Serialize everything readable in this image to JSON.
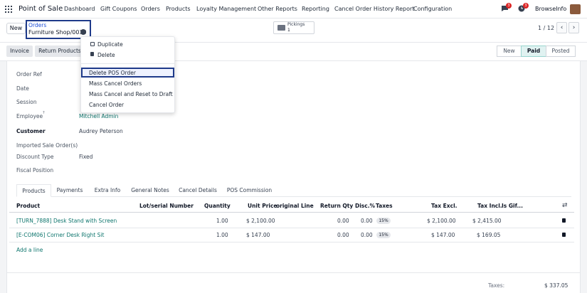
{
  "topnav": {
    "brand": "Point of Sale",
    "menu": [
      "Dashboard",
      "Gift Coupons",
      "Orders",
      "Products",
      "Loyalty Management",
      "Other Reports",
      "Reporting",
      "Cancel Order History Report",
      "Configuration"
    ],
    "chat_badge": "3",
    "activity_badge": "3",
    "user": "BrowseInfo"
  },
  "control": {
    "new_label": "New",
    "breadcrumb_parent": "Orders",
    "breadcrumb_current": "Furniture Shop/0030",
    "pickings_label": "Pickings",
    "pickings_count": "1",
    "pager": "1 / 12",
    "prev": "‹",
    "next": "›"
  },
  "actions": {
    "invoice": "Invoice",
    "return_products": "Return Products"
  },
  "stages": [
    "New",
    "Paid",
    "Posted"
  ],
  "active_stage": "Paid",
  "dropdown": {
    "duplicate": "Duplicate",
    "delete": "Delete",
    "delete_pos_order": "Delete POS Order",
    "mass_cancel": "Mass Cancel Orders",
    "mass_cancel_reset": "Mass Cancel and Reset to Draft",
    "cancel_order": "Cancel Order"
  },
  "form": {
    "order_ref_label": "Order Ref",
    "date_label": "Date",
    "session_label": "Session",
    "employee_label": "Employee",
    "employee_help": "?",
    "employee": "Mitchell Admin",
    "customer_label": "Customer",
    "customer": "Audrey Peterson",
    "imported_label": "Imported Sale Order(s)",
    "discount_type_label": "Discount Type",
    "discount_type": "Fixed",
    "fiscal_position_label": "Fiscal Position"
  },
  "tabs": [
    "Products",
    "Payments",
    "Extra Info",
    "General Notes",
    "Cancel Details",
    "POS Commission"
  ],
  "table": {
    "headers": {
      "product": "Product",
      "lot": "Lot/serial Number",
      "qty": "Quantity",
      "unit_price": "Unit Price",
      "orig_line": "original Line",
      "return_qty": "Return Qty",
      "disc": "Disc.%",
      "taxes": "Taxes",
      "tax_excl": "Tax Excl.",
      "tax_incl": "Tax Incl.",
      "is_gift": "Is Gif..."
    },
    "rows": [
      {
        "product": "[TURN_7888] Desk Stand with Screen",
        "qty": "1.00",
        "unit_price": "$ 2,100.00",
        "return_qty": "0.00",
        "disc": "0.00",
        "tax": "15%",
        "tax_excl": "$ 2,100.00",
        "tax_incl": "$ 2,415.00"
      },
      {
        "product": "[E-COM06] Corner Desk Right Sit",
        "qty": "1.00",
        "unit_price": "$ 147.00",
        "return_qty": "0.00",
        "disc": "0.00",
        "tax": "15%",
        "tax_excl": "$ 147.00",
        "tax_incl": "$ 169.05"
      }
    ],
    "add_line": "Add a line"
  },
  "totals": {
    "taxes_label": "Taxes:",
    "taxes_value": "$ 337.05"
  }
}
